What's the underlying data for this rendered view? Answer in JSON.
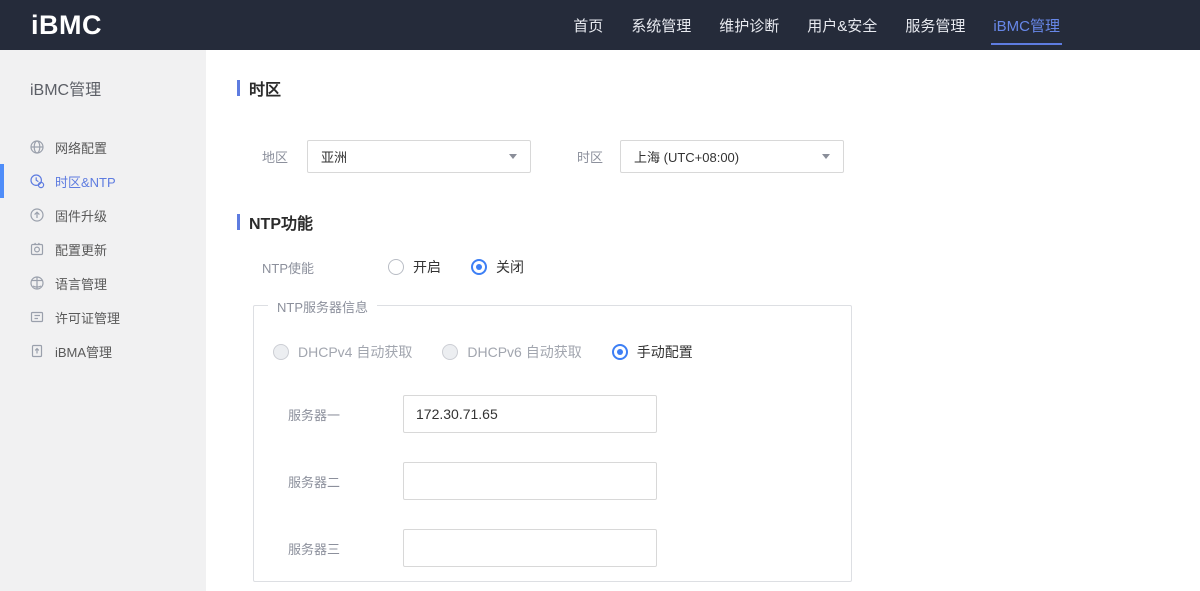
{
  "topbar": {
    "logo": "iBMC",
    "nav": [
      {
        "label": "首页"
      },
      {
        "label": "系统管理"
      },
      {
        "label": "维护诊断"
      },
      {
        "label": "用户&安全"
      },
      {
        "label": "服务管理"
      },
      {
        "label": "iBMC管理"
      }
    ],
    "active_nav": "iBMC管理"
  },
  "sidebar": {
    "title": "iBMC管理",
    "items": [
      {
        "label": "网络配置",
        "icon": "network-icon"
      },
      {
        "label": "时区&NTP",
        "icon": "timezone-icon"
      },
      {
        "label": "固件升级",
        "icon": "firmware-upgrade-icon"
      },
      {
        "label": "配置更新",
        "icon": "config-update-icon"
      },
      {
        "label": "语言管理",
        "icon": "language-icon"
      },
      {
        "label": "许可证管理",
        "icon": "license-icon"
      },
      {
        "label": "iBMA管理",
        "icon": "ibma-icon"
      }
    ],
    "active_item": "时区&NTP",
    "collapse_icon": "‹"
  },
  "main": {
    "timezone_section": {
      "title": "时区",
      "region_label": "地区",
      "region_value": "亚洲",
      "timezone_label": "时区",
      "timezone_value": "上海 (UTC+08:00)"
    },
    "ntp_section": {
      "title": "NTP功能",
      "enable_label": "NTP使能",
      "enable_options": [
        {
          "label": "开启",
          "selected": false
        },
        {
          "label": "关闭",
          "selected": true
        }
      ],
      "server_group": {
        "legend": "NTP服务器信息",
        "mode_options": [
          {
            "label": "DHCPv4 自动获取",
            "selected": false,
            "disabled": true
          },
          {
            "label": "DHCPv6 自动获取",
            "selected": false,
            "disabled": true
          },
          {
            "label": "手动配置",
            "selected": true,
            "disabled": false
          }
        ],
        "servers": [
          {
            "label": "服务器一",
            "value": "172.30.71.65"
          },
          {
            "label": "服务器二",
            "value": ""
          },
          {
            "label": "服务器三",
            "value": ""
          }
        ]
      }
    }
  },
  "colors": {
    "topbar_bg": "#252b3a",
    "accent": "#5e7ce0",
    "radio_selected": "#3d7ff5",
    "sidebar_bg": "#f1f1f2"
  }
}
